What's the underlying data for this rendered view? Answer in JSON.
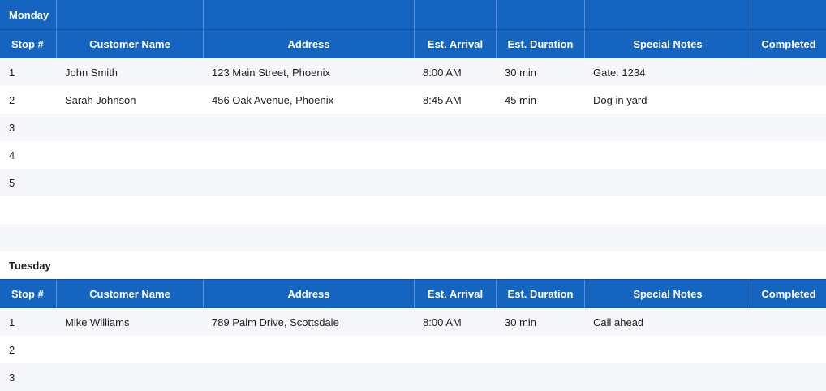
{
  "colors": {
    "header_bg": "#1565c0",
    "header_text": "#ffffff",
    "alt_row": "#f6f7fa"
  },
  "columns": [
    "Stop #",
    "Customer Name",
    "Address",
    "Est. Arrival",
    "Est. Duration",
    "Special Notes",
    "Completed"
  ],
  "days": [
    {
      "name": "Monday",
      "rows": [
        [
          "1",
          "John Smith",
          "123 Main Street, Phoenix",
          "8:00 AM",
          "30 min",
          "Gate: 1234",
          ""
        ],
        [
          "2",
          "Sarah Johnson",
          "456 Oak Avenue, Phoenix",
          "8:45 AM",
          "45 min",
          "Dog in yard",
          ""
        ],
        [
          "3",
          "",
          "",
          "",
          "",
          "",
          ""
        ],
        [
          "4",
          "",
          "",
          "",
          "",
          "",
          ""
        ],
        [
          "5",
          "",
          "",
          "",
          "",
          "",
          ""
        ]
      ]
    },
    {
      "name": "Tuesday",
      "rows": [
        [
          "1",
          "Mike Williams",
          "789 Palm Drive, Scottsdale",
          "8:00 AM",
          "30 min",
          "Call ahead",
          ""
        ],
        [
          "2",
          "",
          "",
          "",
          "",
          "",
          ""
        ],
        [
          "3",
          "",
          "",
          "",
          "",
          "",
          ""
        ]
      ]
    }
  ]
}
